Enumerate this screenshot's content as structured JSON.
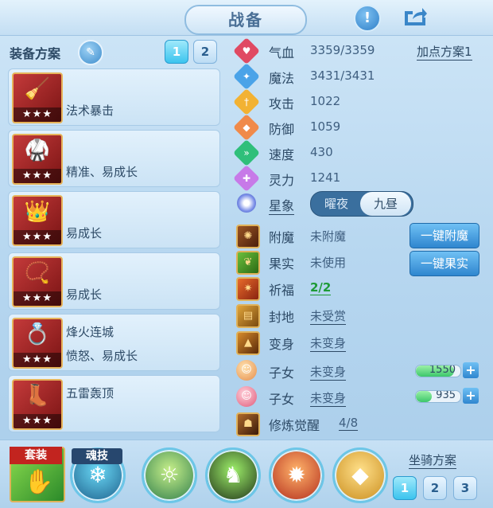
{
  "title": "战备",
  "header": {
    "info_icon": "!",
    "share_icon": "share-icon"
  },
  "left": {
    "plan_label": "装备方案",
    "plan_tabs": [
      "1",
      "2"
    ],
    "active_plan": "1",
    "items": [
      {
        "icon": "mop-weapon",
        "line1": "",
        "line2": "法术暴击",
        "stars": "★★★"
      },
      {
        "icon": "robe-armor",
        "line1": "",
        "line2": "精准、易成长",
        "stars": "★★★"
      },
      {
        "icon": "crown-helmet",
        "line1": "",
        "line2": "易成长",
        "stars": "★★★"
      },
      {
        "icon": "necklace",
        "line1": "",
        "line2": "易成长",
        "stars": "★★★"
      },
      {
        "icon": "belt",
        "line1": "烽火连城",
        "line2": "愤怒、易成长",
        "stars": "★★★"
      },
      {
        "icon": "boots",
        "line1": "五雷轰顶",
        "line2": "",
        "stars": "★★★"
      }
    ]
  },
  "stats": [
    {
      "name": "气血",
      "value": "3359/3359",
      "color": "#e04a63",
      "icon": "heart-icon"
    },
    {
      "name": "魔法",
      "value": "3431/3431",
      "color": "#4aa3e8",
      "icon": "mana-icon"
    },
    {
      "name": "攻击",
      "value": "1022",
      "color": "#f2b233",
      "icon": "sword-icon"
    },
    {
      "name": "防御",
      "value": "1059",
      "color": "#f08a4a",
      "icon": "shield-icon"
    },
    {
      "name": "速度",
      "value": "430",
      "color": "#2fbf7a",
      "icon": "speed-icon"
    },
    {
      "name": "灵力",
      "value": "1241",
      "color": "#c77ae8",
      "icon": "spirit-icon"
    }
  ],
  "addpoint_label": "加点方案1",
  "astro": {
    "label": "星象",
    "options": [
      "曜夜",
      "九昼"
    ],
    "selected": "九昼"
  },
  "extras": [
    {
      "label": "附魔",
      "value": "未附魔",
      "button": "一键附魔"
    },
    {
      "label": "果实",
      "value": "未使用",
      "button": "一键果实"
    },
    {
      "label": "祈福",
      "value": "2/2"
    },
    {
      "label": "封地",
      "value": "未受赏"
    },
    {
      "label": "变身",
      "value": "未变身"
    }
  ],
  "children": [
    {
      "label": "子女",
      "value": "未变身",
      "bar_value": "1550",
      "bar_level": 0.85
    },
    {
      "label": "子女",
      "value": "未变身",
      "bar_value": "935",
      "bar_level": 0.35
    }
  ],
  "awaken": {
    "label": "修炼觉醒",
    "value": "4/8"
  },
  "bottom": {
    "suit_label": "套装",
    "soul_label": "魂技",
    "mount_label": "坐骑方案",
    "mount_tabs": [
      "1",
      "2",
      "3"
    ],
    "active_mount": "1"
  }
}
